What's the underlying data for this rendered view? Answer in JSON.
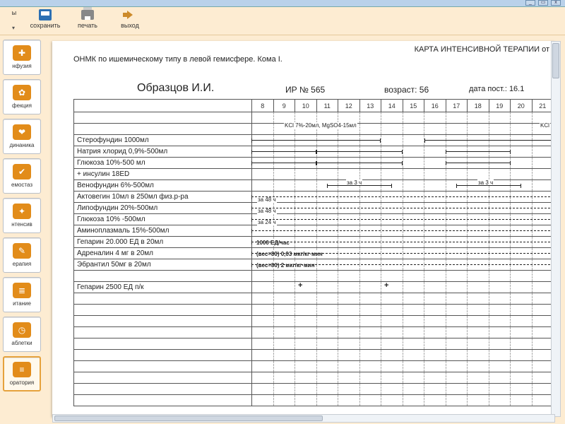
{
  "window": {
    "min": "_",
    "max": "▭",
    "close": "x"
  },
  "toolbar": {
    "arrow": "▾",
    "b0": "ы",
    "save": "сохранить",
    "print": "печать",
    "exit": "выход"
  },
  "sidebar": {
    "items": [
      {
        "label": "нфузия",
        "glyph": "✚"
      },
      {
        "label": "фекция",
        "glyph": "✿"
      },
      {
        "label": "динаника",
        "glyph": "❤"
      },
      {
        "label": "емостаз",
        "glyph": "✔"
      },
      {
        "label": "нтенсив",
        "glyph": "✦"
      },
      {
        "label": "ерапия",
        "glyph": "✎"
      },
      {
        "label": "итание",
        "glyph": "≣"
      },
      {
        "label": "аблетки",
        "glyph": "◷"
      },
      {
        "label": "оратория",
        "glyph": "≡"
      }
    ]
  },
  "doc": {
    "title_right": "КАРТА ИНТЕНСИВНОЙ ТЕРАПИИ от",
    "diagnosis": "ОНМК по ишемическому типу в левой гемисфере. Кома I.",
    "patient": "Образцов И.И.",
    "id": "ИР № 565",
    "age": "возраст: 56",
    "date": "дата пост.: 16.1",
    "hours": [
      "8",
      "9",
      "10",
      "11",
      "12",
      "13",
      "14",
      "15",
      "16",
      "17",
      "18",
      "19",
      "20",
      "21"
    ],
    "rows": [
      {
        "label": ""
      },
      {
        "label": ""
      },
      {
        "label": "Стерофундин 1000мл"
      },
      {
        "label": "Натрия хлорид 0,9%-500мл"
      },
      {
        "label": "Глюкоза 10%-500 мл"
      },
      {
        "label": "  + инсулин 18ЕD"
      },
      {
        "label": "Венофундин 6%-500мл"
      },
      {
        "label": "Актовегин 10мл в 250мл физ.р-ра"
      },
      {
        "label": "Липофундин 20%-500мл"
      },
      {
        "label": "Глюкоза 10% -500мл"
      },
      {
        "label": "Аминоплазмаль 15%-500мл"
      },
      {
        "label": "Гепарин 20.000 ЕД в 20мл"
      },
      {
        "label": "Адреналин 4 мг в 20мл"
      },
      {
        "label": "Эбрантил 50мг в 20мл"
      },
      {
        "label": ""
      },
      {
        "label": "Гепарин 2500 ЕД  п/к"
      },
      {
        "label": ""
      },
      {
        "label": ""
      },
      {
        "label": ""
      },
      {
        "label": ""
      },
      {
        "label": ""
      },
      {
        "label": ""
      },
      {
        "label": ""
      },
      {
        "label": ""
      },
      {
        "label": ""
      },
      {
        "label": ""
      }
    ],
    "annot": {
      "kcl_left": "KCl 7%-20мл, MgSO4-15мл",
      "kcl_right": "KCl",
      "za3": "за 3 ч",
      "za48": "за 48 ч",
      "za24": "за 24 ч",
      "hep": "1000 ЕД/час",
      "adr": "(вес=80)  0,03 мкг/кг·мин",
      "ebr": "(вес=80)  2 мкг/кг·мин",
      "plus": "+"
    }
  }
}
